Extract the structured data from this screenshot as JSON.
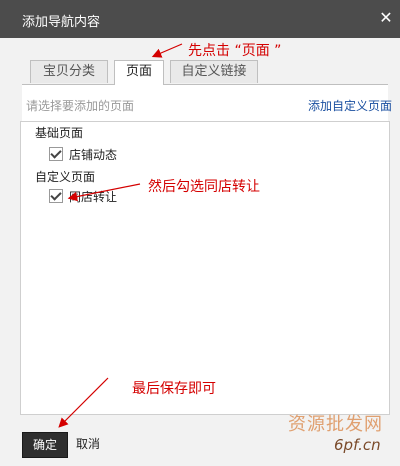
{
  "dialog": {
    "title": "添加导航内容",
    "close_glyph": "✕"
  },
  "tabs": [
    {
      "label": "宝贝分类",
      "active": false
    },
    {
      "label": "页面",
      "active": true
    },
    {
      "label": "自定义链接",
      "active": false
    }
  ],
  "panel": {
    "hint": "请选择要添加的页面",
    "add_link": "添加自定义页面",
    "groups": [
      {
        "label": "基础页面",
        "items": [
          {
            "label": "店铺动态",
            "checked": true
          }
        ]
      },
      {
        "label": "自定义页面",
        "items": [
          {
            "label": "同店转让",
            "checked": true
          }
        ]
      }
    ]
  },
  "footer": {
    "ok_label": "确定",
    "cancel_label": "取消"
  },
  "annotations": {
    "step1": "先点击 “页面 ”",
    "step2": "然后勾选同店转让",
    "step3": "最后保存即可",
    "color": "#d40000"
  },
  "watermark": {
    "text": "资源批发网",
    "url": "6pf.cn"
  }
}
